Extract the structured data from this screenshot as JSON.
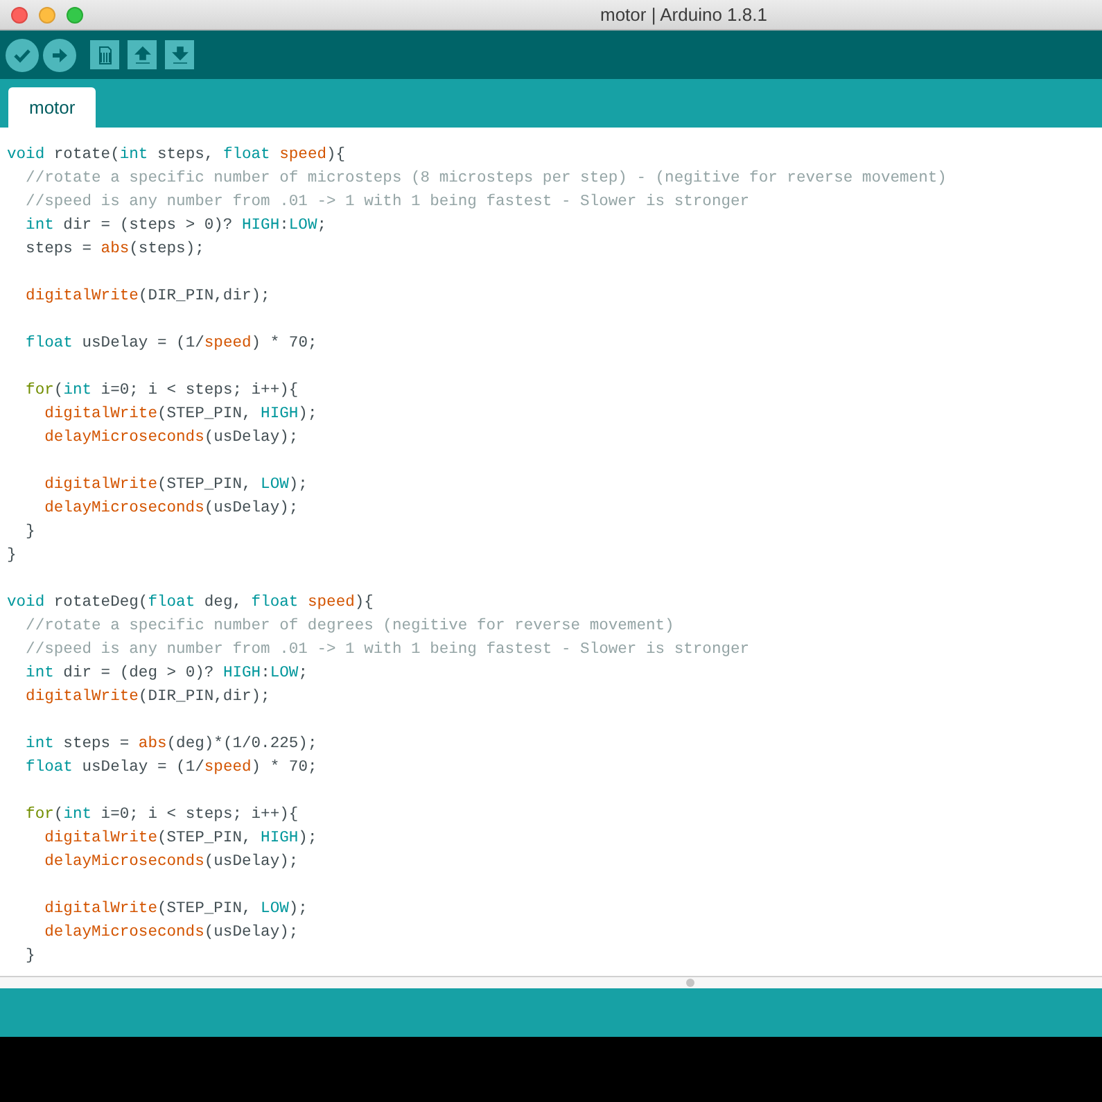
{
  "window": {
    "title": "motor | Arduino 1.8.1"
  },
  "toolbar": {
    "buttons": [
      {
        "kind": "verify"
      },
      {
        "kind": "upload"
      },
      {
        "kind": "new"
      },
      {
        "kind": "open"
      },
      {
        "kind": "save"
      }
    ]
  },
  "tabs": [
    {
      "label": "motor",
      "selected": true
    }
  ],
  "code_lines": [
    {
      "kind": "code",
      "tokens": [
        {
          "kind": "keyword",
          "text": "void"
        },
        {
          "kind": "plain",
          "text": " rotate("
        },
        {
          "kind": "keyword",
          "text": "int"
        },
        {
          "kind": "plain",
          "text": " steps, "
        },
        {
          "kind": "keyword",
          "text": "float"
        },
        {
          "kind": "function",
          "text": " speed"
        },
        {
          "kind": "plain",
          "text": "){"
        }
      ]
    },
    {
      "kind": "code",
      "tokens": [
        {
          "kind": "comment",
          "text": "  //rotate a specific number of microsteps (8 microsteps per step) - (negitive for reverse movement)"
        }
      ]
    },
    {
      "kind": "code",
      "tokens": [
        {
          "kind": "comment",
          "text": "  //speed is any number from .01 -> 1 with 1 being fastest - Slower is stronger"
        }
      ]
    },
    {
      "kind": "code",
      "tokens": [
        {
          "kind": "keyword",
          "text": "  int"
        },
        {
          "kind": "plain",
          "text": " dir = (steps > 0)? "
        },
        {
          "kind": "keyword",
          "text": "HIGH"
        },
        {
          "kind": "plain",
          "text": ":"
        },
        {
          "kind": "keyword",
          "text": "LOW"
        },
        {
          "kind": "plain",
          "text": ";"
        }
      ]
    },
    {
      "kind": "code",
      "tokens": [
        {
          "kind": "plain",
          "text": "  steps = "
        },
        {
          "kind": "function",
          "text": "abs"
        },
        {
          "kind": "plain",
          "text": "(steps);"
        }
      ]
    },
    {
      "kind": "blank"
    },
    {
      "kind": "code",
      "tokens": [
        {
          "kind": "function",
          "text": "  digitalWrite"
        },
        {
          "kind": "plain",
          "text": "(DIR_PIN,dir);"
        }
      ]
    },
    {
      "kind": "blank"
    },
    {
      "kind": "code",
      "tokens": [
        {
          "kind": "keyword",
          "text": "  float"
        },
        {
          "kind": "plain",
          "text": " usDelay = (1/"
        },
        {
          "kind": "function",
          "text": "speed"
        },
        {
          "kind": "plain",
          "text": ") * 70;"
        }
      ]
    },
    {
      "kind": "blank"
    },
    {
      "kind": "code",
      "tokens": [
        {
          "kind": "control",
          "text": "  for"
        },
        {
          "kind": "plain",
          "text": "("
        },
        {
          "kind": "keyword",
          "text": "int"
        },
        {
          "kind": "plain",
          "text": " i=0; i < steps; i++){"
        }
      ]
    },
    {
      "kind": "code",
      "tokens": [
        {
          "kind": "function",
          "text": "    digitalWrite"
        },
        {
          "kind": "plain",
          "text": "(STEP_PIN, "
        },
        {
          "kind": "keyword",
          "text": "HIGH"
        },
        {
          "kind": "plain",
          "text": ");"
        }
      ]
    },
    {
      "kind": "code",
      "tokens": [
        {
          "kind": "function",
          "text": "    delayMicroseconds"
        },
        {
          "kind": "plain",
          "text": "(usDelay);"
        }
      ]
    },
    {
      "kind": "blank"
    },
    {
      "kind": "code",
      "tokens": [
        {
          "kind": "function",
          "text": "    digitalWrite"
        },
        {
          "kind": "plain",
          "text": "(STEP_PIN, "
        },
        {
          "kind": "keyword",
          "text": "LOW"
        },
        {
          "kind": "plain",
          "text": ");"
        }
      ]
    },
    {
      "kind": "code",
      "tokens": [
        {
          "kind": "function",
          "text": "    delayMicroseconds"
        },
        {
          "kind": "plain",
          "text": "(usDelay);"
        }
      ]
    },
    {
      "kind": "code",
      "tokens": [
        {
          "kind": "plain",
          "text": "  }"
        }
      ]
    },
    {
      "kind": "code",
      "tokens": [
        {
          "kind": "plain",
          "text": "}"
        }
      ]
    },
    {
      "kind": "blank"
    },
    {
      "kind": "code",
      "tokens": [
        {
          "kind": "keyword",
          "text": "void"
        },
        {
          "kind": "plain",
          "text": " rotateDeg("
        },
        {
          "kind": "keyword",
          "text": "float"
        },
        {
          "kind": "plain",
          "text": " deg, "
        },
        {
          "kind": "keyword",
          "text": "float"
        },
        {
          "kind": "function",
          "text": " speed"
        },
        {
          "kind": "plain",
          "text": "){"
        }
      ]
    },
    {
      "kind": "code",
      "tokens": [
        {
          "kind": "comment",
          "text": "  //rotate a specific number of degrees (negitive for reverse movement)"
        }
      ]
    },
    {
      "kind": "code",
      "tokens": [
        {
          "kind": "comment",
          "text": "  //speed is any number from .01 -> 1 with 1 being fastest - Slower is stronger"
        }
      ]
    },
    {
      "kind": "code",
      "tokens": [
        {
          "kind": "keyword",
          "text": "  int"
        },
        {
          "kind": "plain",
          "text": " dir = (deg > 0)? "
        },
        {
          "kind": "keyword",
          "text": "HIGH"
        },
        {
          "kind": "plain",
          "text": ":"
        },
        {
          "kind": "keyword",
          "text": "LOW"
        },
        {
          "kind": "plain",
          "text": ";"
        }
      ]
    },
    {
      "kind": "code",
      "tokens": [
        {
          "kind": "function",
          "text": "  digitalWrite"
        },
        {
          "kind": "plain",
          "text": "(DIR_PIN,dir);"
        }
      ]
    },
    {
      "kind": "blank"
    },
    {
      "kind": "code",
      "tokens": [
        {
          "kind": "keyword",
          "text": "  int"
        },
        {
          "kind": "plain",
          "text": " steps = "
        },
        {
          "kind": "function",
          "text": "abs"
        },
        {
          "kind": "plain",
          "text": "(deg)*(1/0.225);"
        }
      ]
    },
    {
      "kind": "code",
      "tokens": [
        {
          "kind": "keyword",
          "text": "  float"
        },
        {
          "kind": "plain",
          "text": " usDelay = (1/"
        },
        {
          "kind": "function",
          "text": "speed"
        },
        {
          "kind": "plain",
          "text": ") * 70;"
        }
      ]
    },
    {
      "kind": "blank"
    },
    {
      "kind": "code",
      "tokens": [
        {
          "kind": "control",
          "text": "  for"
        },
        {
          "kind": "plain",
          "text": "("
        },
        {
          "kind": "keyword",
          "text": "int"
        },
        {
          "kind": "plain",
          "text": " i=0; i < steps; i++){"
        }
      ]
    },
    {
      "kind": "code",
      "tokens": [
        {
          "kind": "function",
          "text": "    digitalWrite"
        },
        {
          "kind": "plain",
          "text": "(STEP_PIN, "
        },
        {
          "kind": "keyword",
          "text": "HIGH"
        },
        {
          "kind": "plain",
          "text": ");"
        }
      ]
    },
    {
      "kind": "code",
      "tokens": [
        {
          "kind": "function",
          "text": "    delayMicroseconds"
        },
        {
          "kind": "plain",
          "text": "(usDelay);"
        }
      ]
    },
    {
      "kind": "blank"
    },
    {
      "kind": "code",
      "tokens": [
        {
          "kind": "function",
          "text": "    digitalWrite"
        },
        {
          "kind": "plain",
          "text": "(STEP_PIN, "
        },
        {
          "kind": "keyword",
          "text": "LOW"
        },
        {
          "kind": "plain",
          "text": ");"
        }
      ]
    },
    {
      "kind": "code",
      "tokens": [
        {
          "kind": "function",
          "text": "    delayMicroseconds"
        },
        {
          "kind": "plain",
          "text": "(usDelay);"
        }
      ]
    },
    {
      "kind": "code",
      "tokens": [
        {
          "kind": "plain",
          "text": "  }"
        }
      ]
    }
  ]
}
